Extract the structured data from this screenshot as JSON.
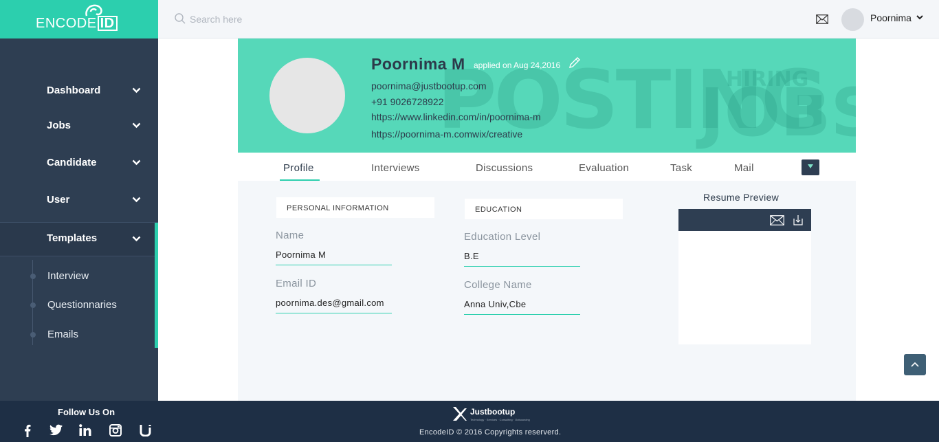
{
  "brand": {
    "logo_text": "ENCODE",
    "logo_id": "ID"
  },
  "header": {
    "search_placeholder": "Search here",
    "user_name": "Poornima",
    "icons": [
      "search-icon",
      "mail-icon",
      "chevron-down-icon"
    ]
  },
  "sidebar": {
    "items": [
      {
        "label": "Dashboard"
      },
      {
        "label": "Jobs"
      },
      {
        "label": "Candidate"
      },
      {
        "label": "User"
      },
      {
        "label": "Templates"
      }
    ],
    "active": "Templates",
    "sub_items": [
      {
        "label": "Interview"
      },
      {
        "label": "Questionnaries"
      },
      {
        "label": "Emails"
      }
    ]
  },
  "candidate": {
    "name": "Poornima M",
    "applied": "applied on Aug 24,2016",
    "email": "poornima@justbootup.com",
    "phone": "+91 9026728922",
    "linkedin": "https://www.linkedin.com/in/poornima-m",
    "website": "https://poornima-m.comwix/creative"
  },
  "banner_words": [
    "POSTING",
    "JOBS",
    "HIRING"
  ],
  "tabs": [
    {
      "label": "Profile"
    },
    {
      "label": "Interviews"
    },
    {
      "label": "Discussions"
    },
    {
      "label": "Evaluation"
    },
    {
      "label": "Task"
    },
    {
      "label": "Mail"
    }
  ],
  "active_tab": "Profile",
  "personal": {
    "heading": "PERSONAL INFORMATION",
    "name_label": "Name",
    "name_value": "Poornima M",
    "email_label": "Email ID",
    "email_value": "poornima.des@gmail.com"
  },
  "education": {
    "heading": "EDUCATION",
    "level_label": "Education Level",
    "level_value": "B.E",
    "college_label": "College Name",
    "college_value": "Anna Univ,Cbe"
  },
  "resume": {
    "title": "Resume Preview"
  },
  "footer": {
    "follow": "Follow Us On",
    "company": "Justbootup",
    "tagline": "Technology · Services · Consulting · Outsourcing",
    "copyright": "EncodeID © 2016 Copyrights reserverd.",
    "social_icons": [
      "facebook-icon",
      "twitter-icon",
      "linkedin-icon",
      "instagram-icon",
      "justbootup-icon"
    ]
  },
  "colors": {
    "accent": "#2ccfae",
    "banner": "#56d8b9",
    "sidebar": "#2e3e52",
    "footer": "#1e2f45"
  }
}
